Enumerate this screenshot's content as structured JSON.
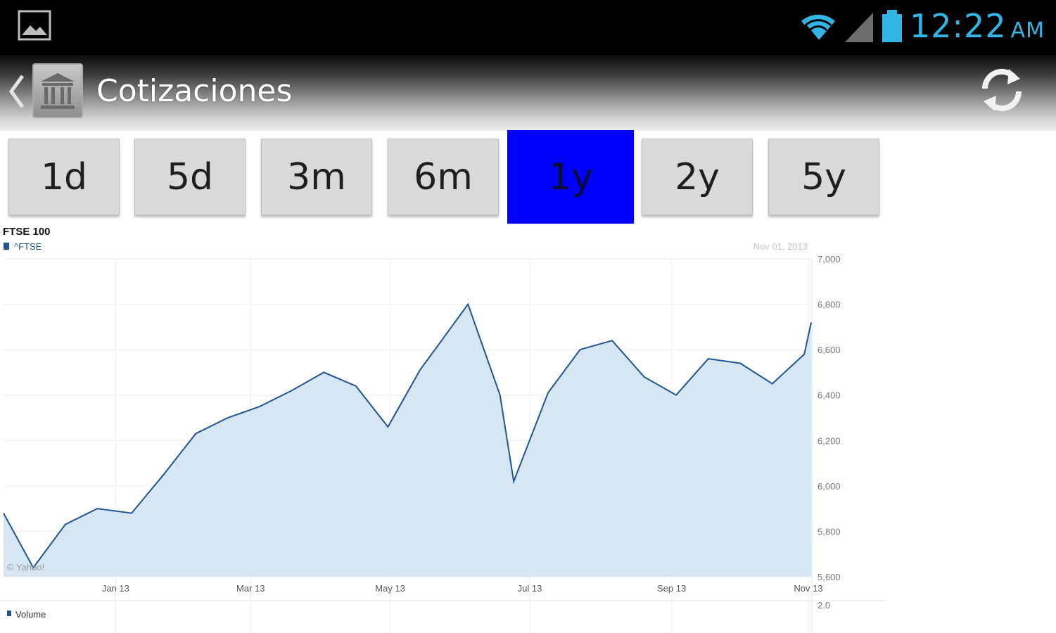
{
  "status_bar": {
    "time": "12:22",
    "ampm": "AM",
    "accent": "#33b5e5",
    "icons": [
      "gallery-icon",
      "wifi-icon",
      "signal-icon",
      "battery-icon"
    ]
  },
  "action_bar": {
    "title": "Cotizaciones",
    "icons": [
      "back-chevron-icon",
      "bank-icon",
      "refresh-icon"
    ]
  },
  "ranges": [
    {
      "label": "1d",
      "active": false
    },
    {
      "label": "5d",
      "active": false
    },
    {
      "label": "3m",
      "active": false
    },
    {
      "label": "6m",
      "active": false
    },
    {
      "label": "1y",
      "active": true
    },
    {
      "label": "2y",
      "active": false
    },
    {
      "label": "5y",
      "active": false
    }
  ],
  "colors": {
    "active_range": "#0000ff",
    "line": "#1f5590",
    "area": "#d6e6f2"
  },
  "chart": {
    "title": "FTSE 100",
    "legend": "^FTSE",
    "date_label": "Nov 01, 2013",
    "watermark": "© Yahoo!",
    "volume_label": "Volume",
    "volume_tick": "2.0"
  },
  "chart_data": {
    "type": "area",
    "title": "FTSE 100",
    "series": [
      {
        "name": "^FTSE",
        "x": [
          "Nov 13",
          "Nov 26",
          "Dec 10",
          "Dec 24",
          "Jan 08",
          "Jan 22",
          "Feb 05",
          "Feb 19",
          "Mar 05",
          "Mar 19",
          "Apr 02",
          "Apr 16",
          "Apr 30",
          "May 14",
          "May 22",
          "Jun 04",
          "Jun 18",
          "Jun 24",
          "Jul 09",
          "Jul 23",
          "Aug 06",
          "Aug 20",
          "Sep 03",
          "Sep 17",
          "Oct 01",
          "Oct 15",
          "Oct 29",
          "Nov 01"
        ],
        "values": [
          5880,
          5640,
          5830,
          5900,
          5880,
          6050,
          6230,
          6300,
          6350,
          6420,
          6500,
          6440,
          6260,
          6510,
          6620,
          6800,
          6400,
          6020,
          6410,
          6600,
          6640,
          6480,
          6400,
          6560,
          6540,
          6450,
          6580,
          6720
        ]
      }
    ],
    "x_ticks": [
      "Jan 13",
      "Mar 13",
      "May 13",
      "Jul 13",
      "Sep 13",
      "Nov 13"
    ],
    "y_ticks": [
      "7,000",
      "6,800",
      "6,600",
      "6,400",
      "6,200",
      "6,000",
      "5,800",
      "5,600"
    ],
    "ylim": [
      5600,
      7000
    ],
    "grid": true,
    "legend_position": "top-left"
  }
}
